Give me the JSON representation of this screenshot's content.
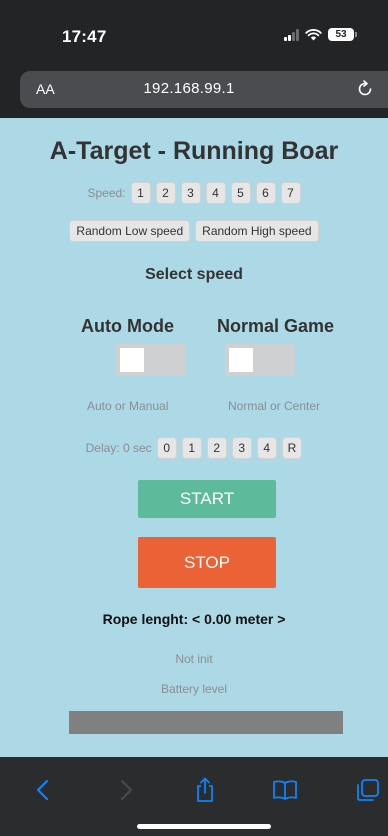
{
  "status_bar": {
    "time": "17:47",
    "battery": "53"
  },
  "url_bar": {
    "aa_label": "AA",
    "url": "192.168.99.1"
  },
  "page": {
    "title": "A-Target - Running Boar",
    "speed_label": "Speed:",
    "speed_buttons": [
      "1",
      "2",
      "3",
      "4",
      "5",
      "6",
      "7"
    ],
    "random_low_label": "Random Low speed",
    "random_high_label": "Random High speed",
    "select_speed_text": "Select speed",
    "auto_mode": {
      "label": "Auto Mode",
      "sub": "Auto or Manual",
      "on": false
    },
    "normal_game": {
      "label": "Normal Game",
      "sub": "Normal or Center",
      "on": false
    },
    "delay_label": "Delay: 0 sec",
    "delay_buttons": [
      "0",
      "1",
      "2",
      "3",
      "4",
      "R"
    ],
    "start_label": "START",
    "stop_label": "STOP",
    "rope_text": "Rope lenght: < 0.00 meter >",
    "init_status": "Not init",
    "battery_label": "Battery level",
    "battery_level": 0
  },
  "colors": {
    "page_bg": "#add8e6",
    "start": "#5dbb9c",
    "stop": "#ea6235",
    "battery_bar": "#808080",
    "toolbar_accent": "#0a84ff"
  },
  "toolbar": {
    "icons": [
      "back-icon",
      "forward-icon",
      "share-icon",
      "bookmarks-icon",
      "tabs-icon"
    ]
  }
}
